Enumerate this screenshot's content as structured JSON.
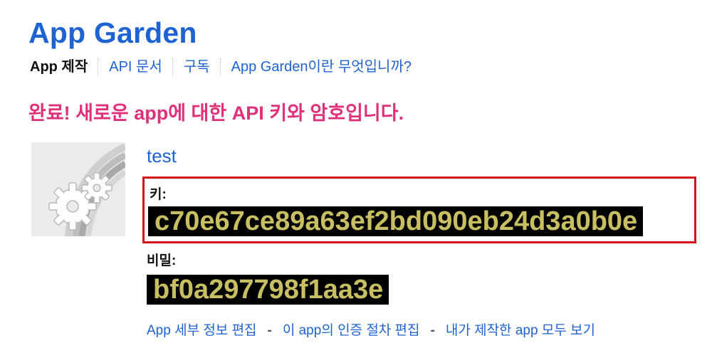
{
  "header": {
    "title": "App Garden"
  },
  "nav": {
    "items": [
      {
        "label": "App 제작",
        "active": true
      },
      {
        "label": "API 문서",
        "active": false
      },
      {
        "label": "구독",
        "active": false
      },
      {
        "label": "App Garden이란 무엇입니까?",
        "active": false
      }
    ]
  },
  "main": {
    "success_message": "완료! 새로운 app에 대한 API 키와 암호입니다.",
    "app": {
      "icon": "gears-rainbow-icon",
      "name": "test"
    },
    "key": {
      "label": "키:",
      "value": "c70e67ce89a63ef2bd090eb24d3a0b0e"
    },
    "secret": {
      "label": "비밀:",
      "value": "bf0a297798f1aa3e"
    },
    "actions": {
      "edit_details": "App 세부 정보 편집",
      "separator": "-",
      "edit_auth": "이 app의 인증 절차 편집",
      "view_all": "내가 제작한 app 모두 보기"
    }
  },
  "colors": {
    "link": "#1f63d3",
    "success": "#e0307a",
    "highlight_border": "#d4131b",
    "code_text": "#c8bf62",
    "code_bg": "#000000"
  }
}
